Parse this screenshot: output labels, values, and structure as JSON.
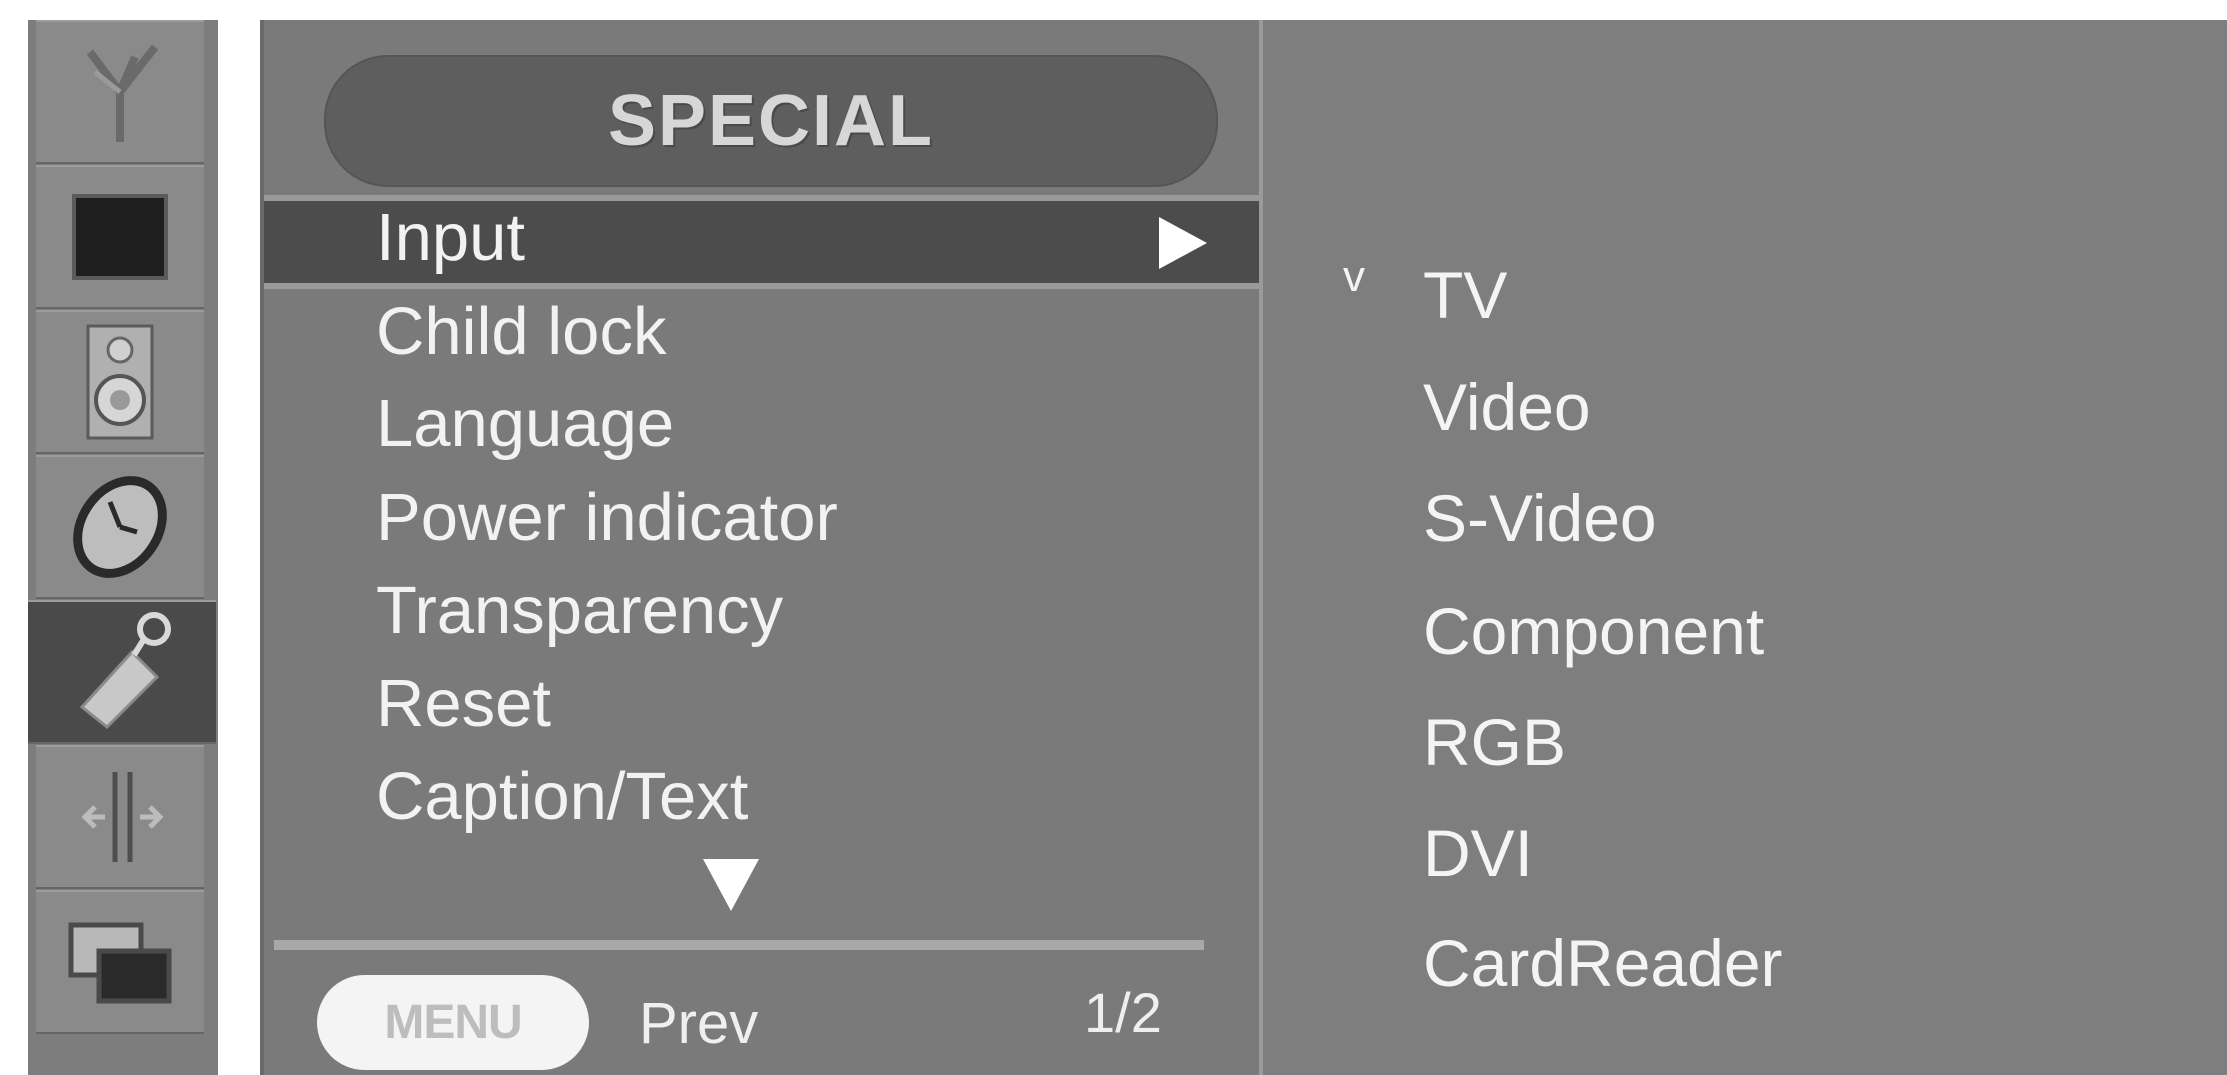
{
  "icon_strip": {
    "icons": [
      {
        "name": "antenna-icon"
      },
      {
        "name": "screen-icon"
      },
      {
        "name": "speaker-icon"
      },
      {
        "name": "clock-icon"
      },
      {
        "name": "tool-icon",
        "selected": true
      },
      {
        "name": "adjust-icon"
      },
      {
        "name": "pip-icon"
      }
    ]
  },
  "menu": {
    "title": "SPECIAL",
    "items": [
      {
        "label": "Input",
        "highlighted": true,
        "has_submenu": true
      },
      {
        "label": "Child lock"
      },
      {
        "label": "Language"
      },
      {
        "label": "Power indicator"
      },
      {
        "label": "Transparency"
      },
      {
        "label": "Reset"
      },
      {
        "label": "Caption/Text"
      }
    ],
    "footer": {
      "menu_button_label": "MENU",
      "prev_label": "Prev",
      "page_indicator": "1/2"
    }
  },
  "options": {
    "selected_marker": "v",
    "items": [
      {
        "label": "TV",
        "selected": true
      },
      {
        "label": "Video"
      },
      {
        "label": "S-Video"
      },
      {
        "label": "Component"
      },
      {
        "label": "RGB"
      },
      {
        "label": "DVI"
      },
      {
        "label": "CardReader"
      }
    ]
  },
  "colors": {
    "panel": "#7a7a7a",
    "highlight": "#4c4c4c",
    "text": "#f2f2f2"
  }
}
